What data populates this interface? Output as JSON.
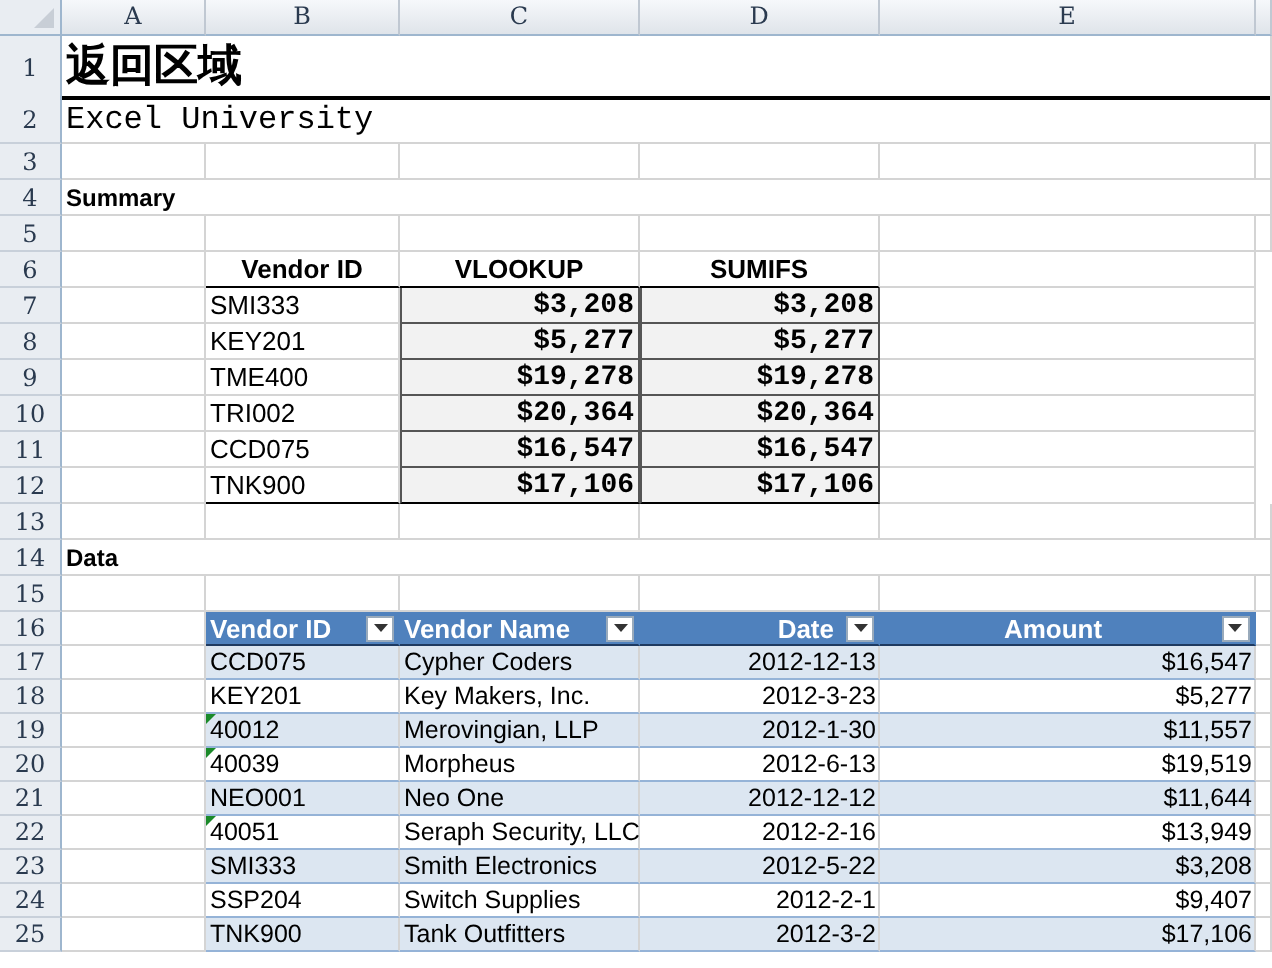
{
  "column_headers": [
    "A",
    "B",
    "C",
    "D",
    "E"
  ],
  "rows": [
    {
      "number": "1",
      "kind": "title",
      "text": "返回区域"
    },
    {
      "number": "2",
      "kind": "subtitle",
      "text": "Excel University"
    },
    {
      "number": "3",
      "kind": "blank"
    },
    {
      "number": "4",
      "kind": "section",
      "text": "Summary"
    },
    {
      "number": "5",
      "kind": "blank"
    },
    {
      "number": "6",
      "kind": "summary_header",
      "cells": [
        "Vendor ID",
        "VLOOKUP",
        "SUMIFS"
      ]
    },
    {
      "number": "7",
      "kind": "summary_row",
      "cells": [
        "SMI333",
        "$3,208",
        "$3,208"
      ]
    },
    {
      "number": "8",
      "kind": "summary_row",
      "cells": [
        "KEY201",
        "$5,277",
        "$5,277"
      ]
    },
    {
      "number": "9",
      "kind": "summary_row",
      "cells": [
        "TME400",
        "$19,278",
        "$19,278"
      ]
    },
    {
      "number": "10",
      "kind": "summary_row",
      "cells": [
        "TRI002",
        "$20,364",
        "$20,364"
      ]
    },
    {
      "number": "11",
      "kind": "summary_row",
      "cells": [
        "CCD075",
        "$16,547",
        "$16,547"
      ]
    },
    {
      "number": "12",
      "kind": "summary_row",
      "cells": [
        "TNK900",
        "$17,106",
        "$17,106"
      ]
    },
    {
      "number": "13",
      "kind": "blank"
    },
    {
      "number": "14",
      "kind": "section",
      "text": "Data"
    },
    {
      "number": "15",
      "kind": "blank"
    },
    {
      "number": "16",
      "kind": "table_header",
      "cells": [
        "Vendor ID",
        "Vendor Name",
        "Date",
        "Amount"
      ]
    },
    {
      "number": "17",
      "kind": "table_row",
      "warning": false,
      "cells": [
        "CCD075",
        "Cypher Coders",
        "2012-12-13",
        "$16,547"
      ]
    },
    {
      "number": "18",
      "kind": "table_row",
      "warning": false,
      "cells": [
        "KEY201",
        "Key Makers, Inc.",
        "2012-3-23",
        "$5,277"
      ]
    },
    {
      "number": "19",
      "kind": "table_row",
      "warning": true,
      "cells": [
        "40012",
        "Merovingian, LLP",
        "2012-1-30",
        "$11,557"
      ]
    },
    {
      "number": "20",
      "kind": "table_row",
      "warning": true,
      "cells": [
        "40039",
        "Morpheus",
        "2012-6-13",
        "$19,519"
      ]
    },
    {
      "number": "21",
      "kind": "table_row",
      "warning": false,
      "cells": [
        "NEO001",
        "Neo One",
        "2012-12-12",
        "$11,644"
      ]
    },
    {
      "number": "22",
      "kind": "table_row",
      "warning": true,
      "cells": [
        "40051",
        "Seraph Security, LLC",
        "2012-2-16",
        "$13,949"
      ]
    },
    {
      "number": "23",
      "kind": "table_row",
      "warning": false,
      "cells": [
        "SMI333",
        "Smith Electronics",
        "2012-5-22",
        "$3,208"
      ]
    },
    {
      "number": "24",
      "kind": "table_row",
      "warning": false,
      "cells": [
        "SSP204",
        "Switch Supplies",
        "2012-2-1",
        "$9,407"
      ]
    },
    {
      "number": "25",
      "kind": "table_row",
      "warning": false,
      "cells": [
        "TNK900",
        "Tank Outfitters",
        "2012-3-2",
        "$17,106"
      ]
    }
  ]
}
